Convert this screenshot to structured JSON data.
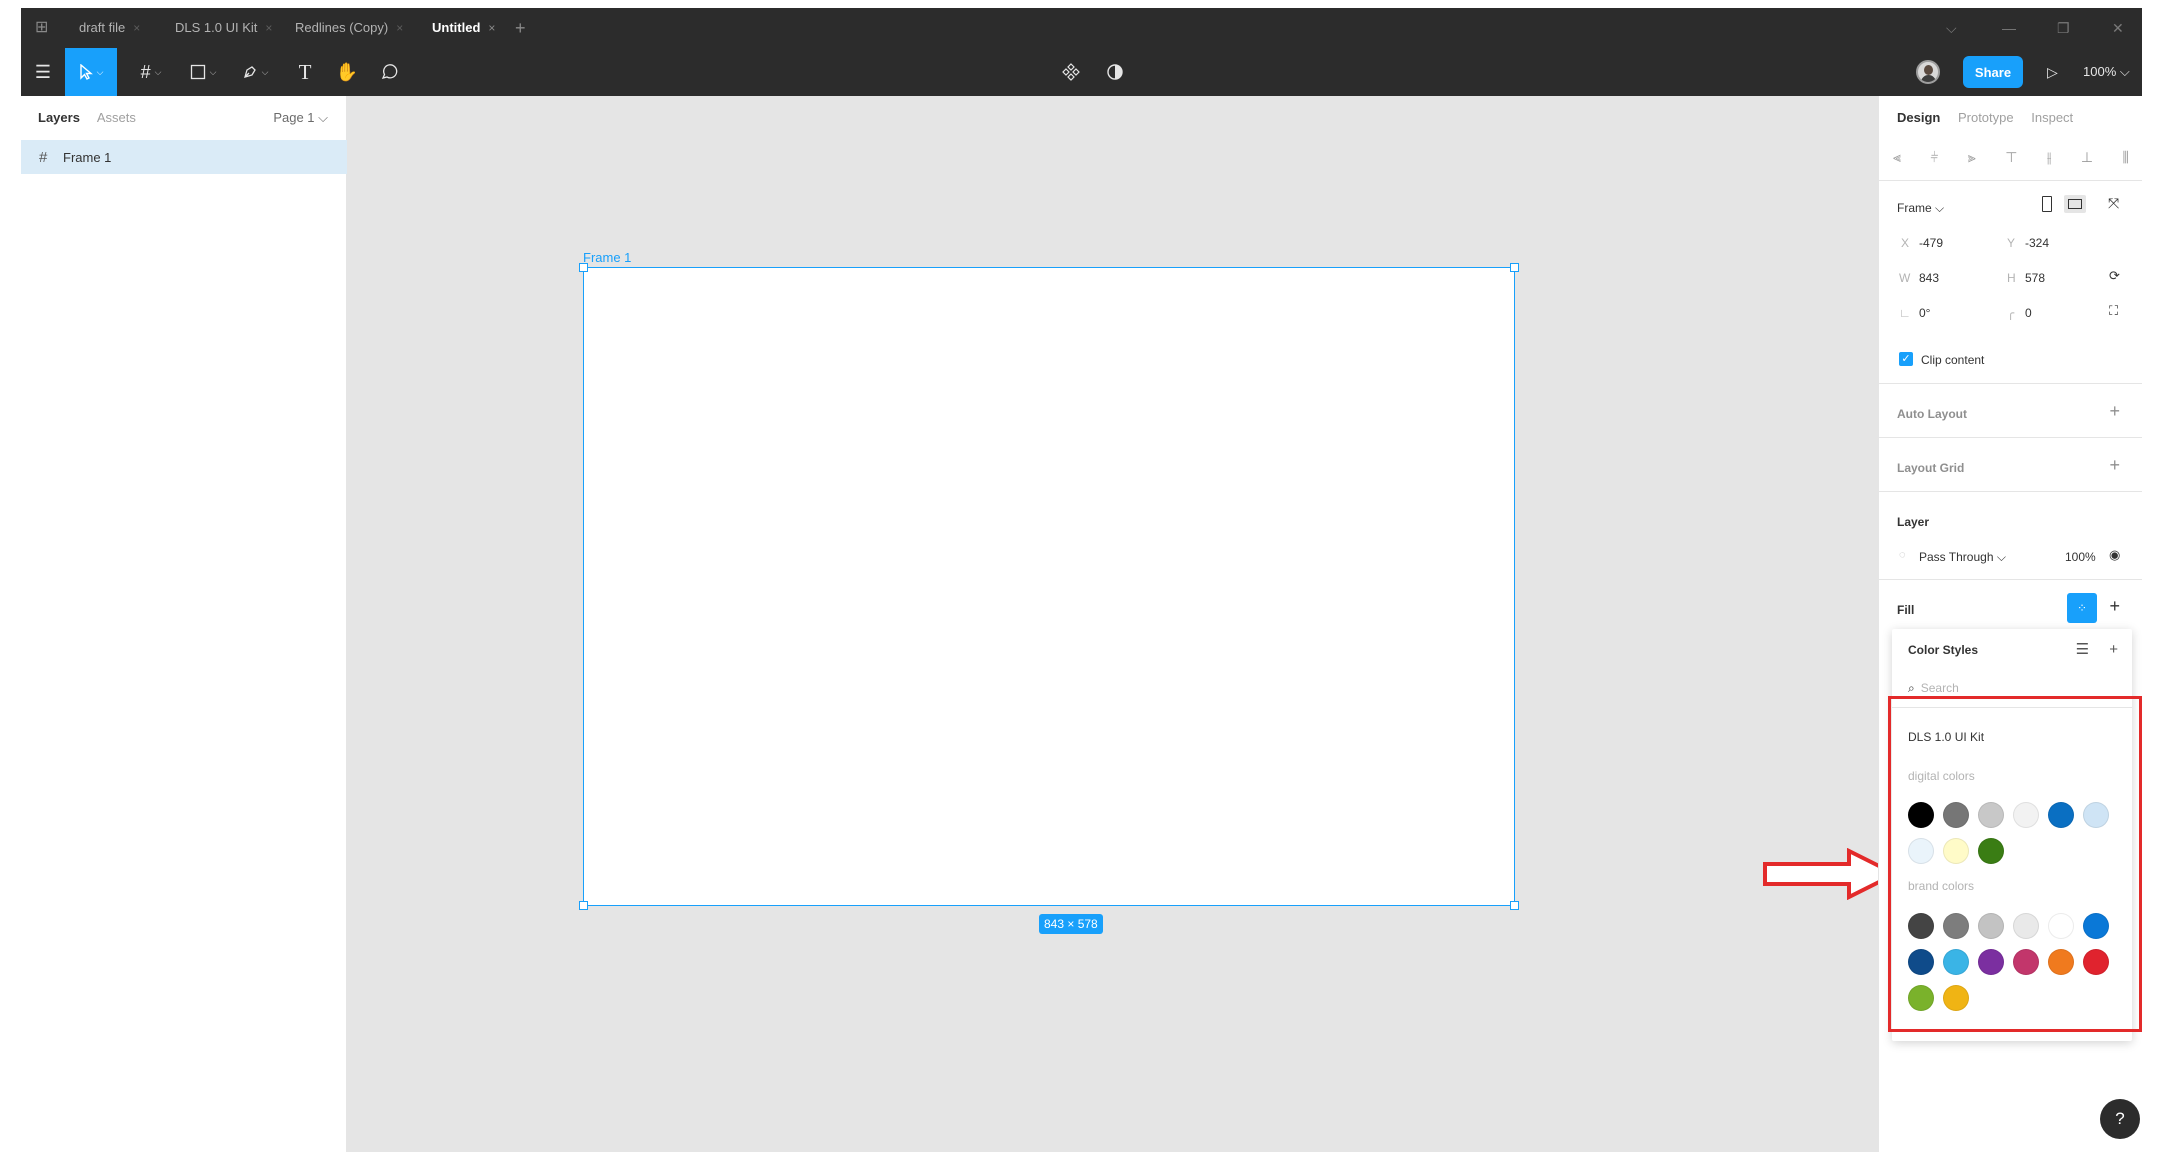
{
  "titlebar": {
    "tabs": [
      {
        "label": "draft file",
        "active": false
      },
      {
        "label": "DLS 1.0 UI Kit",
        "active": false
      },
      {
        "label": "Redlines (Copy)",
        "active": false
      },
      {
        "label": "Untitled",
        "active": true
      }
    ],
    "close_glyph": "×",
    "new_tab_glyph": "+",
    "window_controls": {
      "dropdown": "⌵",
      "minimize": "—",
      "restore": "❐",
      "close": "✕"
    }
  },
  "toolbar": {
    "share_label": "Share",
    "zoom_label": "100% ⌵",
    "icons": [
      "main-menu-icon",
      "move-tool-icon",
      "frame-tool-icon",
      "shape-tool-icon",
      "pen-tool-icon",
      "text-tool-icon",
      "hand-tool-icon",
      "comment-tool-icon",
      "components-icon",
      "mask-icon",
      "play-icon"
    ]
  },
  "left_panel": {
    "tabs": [
      "Layers",
      "Assets"
    ],
    "page_selector": "Page 1 ⌵",
    "layers": [
      {
        "name": "Frame 1",
        "icon": "frame-icon"
      }
    ]
  },
  "canvas": {
    "frame_label": "Frame 1",
    "dimensions_badge": "843 × 578"
  },
  "right_panel": {
    "tabs": [
      "Design",
      "Prototype",
      "Inspect"
    ],
    "frame_preset": "Frame ⌵",
    "x_label": "X",
    "x_value": "-479",
    "y_label": "Y",
    "y_value": "-324",
    "w_label": "W",
    "w_value": "843",
    "h_label": "H",
    "h_value": "578",
    "rotation_value": "0°",
    "radius_value": "0",
    "clip_content_label": "Clip content",
    "clip_content_checked": true,
    "auto_layout_label": "Auto Layout",
    "layout_grid_label": "Layout Grid",
    "layer_label": "Layer",
    "blend_mode": "Pass Through ⌵",
    "opacity": "100%",
    "fill_label": "Fill"
  },
  "color_styles": {
    "title": "Color Styles",
    "search_placeholder": "Search",
    "library_name": "DLS 1.0 UI Kit",
    "groups": [
      {
        "label": "digital colors",
        "colors": [
          "#000000",
          "#767676",
          "#c8c8c8",
          "#f2f2f2",
          "#0a6fc2",
          "#cfe4f5",
          "#eaf4fb",
          "#fffbc8",
          "#3a7d14"
        ]
      },
      {
        "label": "brand colors",
        "colors": [
          "#444444",
          "#7d7d7d",
          "#c3c3c3",
          "#e9e9e9",
          "#ffffff",
          "#0a78d7",
          "#0f4b8a",
          "#3ab4e6",
          "#7b2fa0",
          "#c2366b",
          "#f07a1e",
          "#e0232e",
          "#7ab22b",
          "#f0b414"
        ]
      }
    ]
  },
  "annotation": {
    "highlight_color": "#e32a2a"
  },
  "help_label": "?"
}
